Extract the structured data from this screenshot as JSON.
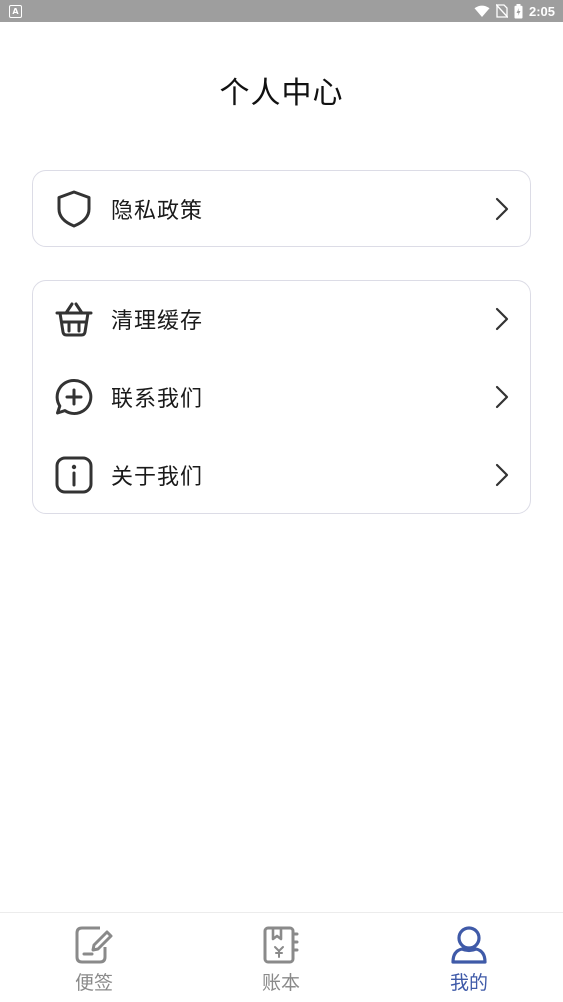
{
  "status_bar": {
    "left_icon": "A",
    "time": "2:05",
    "icons": [
      "wifi-icon",
      "no-sim-icon",
      "battery-icon"
    ]
  },
  "header": {
    "title": "个人中心"
  },
  "menu_group_1": [
    {
      "label": "隐私政策",
      "icon": "shield-icon"
    }
  ],
  "menu_group_2": [
    {
      "label": "清理缓存",
      "icon": "basket-icon"
    },
    {
      "label": "联系我们",
      "icon": "chat-plus-icon"
    },
    {
      "label": "关于我们",
      "icon": "info-icon"
    }
  ],
  "tab_bar": {
    "active": "我的",
    "active_color": "#3f5aa8",
    "inactive_color": "#8a8a8a",
    "tabs": [
      {
        "label": "便签",
        "icon": "note-edit-icon"
      },
      {
        "label": "账本",
        "icon": "ledger-book-icon"
      },
      {
        "label": "我的",
        "icon": "user-icon"
      }
    ]
  }
}
